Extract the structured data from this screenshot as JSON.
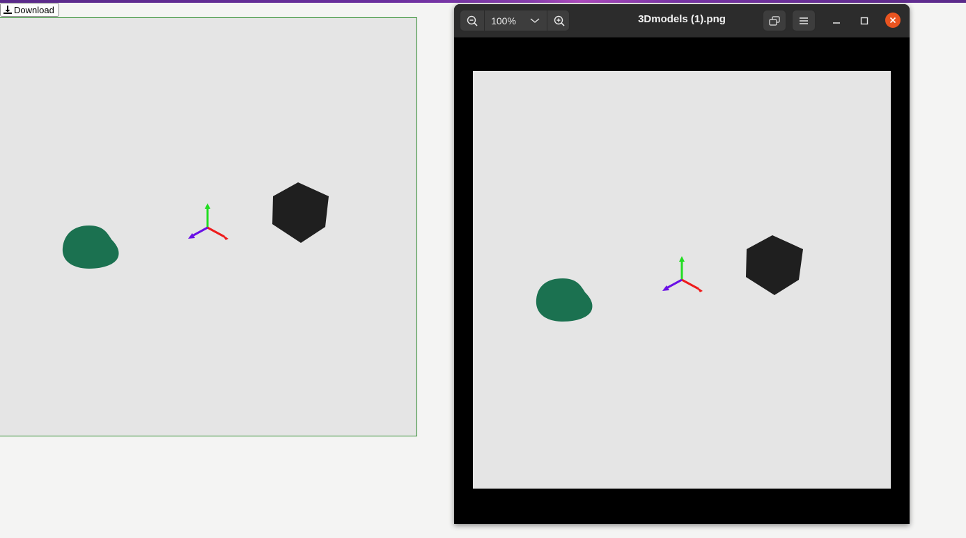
{
  "page": {
    "download_label": "Download",
    "download_icon": "download-icon"
  },
  "viewer": {
    "title": "3Dmodels (1).png",
    "zoom_level": "100%",
    "icons": {
      "zoom_out": "zoom-out-icon",
      "zoom_menu": "chevron-down-icon",
      "zoom_in": "zoom-in-icon",
      "gallery": "gallery-icon",
      "menu": "hamburger-menu-icon",
      "minimize": "minimize-icon",
      "maximize": "maximize-icon",
      "close": "close-icon"
    }
  },
  "scene": {
    "background": "#e5e5e5",
    "cone_color": "#1b7150",
    "cube_color": "#1f1f1f",
    "axis_x_color": "#ee1c1c",
    "axis_y_color": "#22dd22",
    "axis_z_color": "#6a10e6"
  }
}
